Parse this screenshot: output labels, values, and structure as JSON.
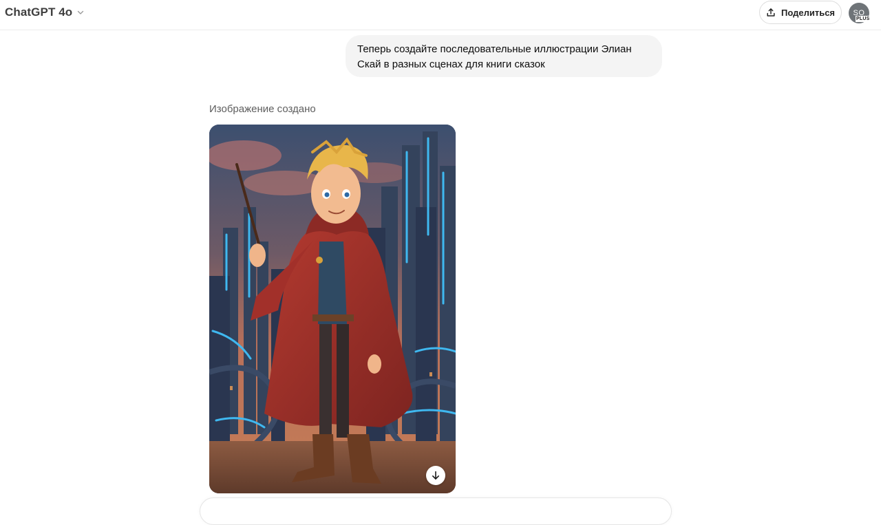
{
  "header": {
    "model_name": "ChatGPT 4o",
    "share_label": "Поделиться",
    "avatar_initials": "SO",
    "plan_badge": "PLUS"
  },
  "conversation": {
    "user_message": "Теперь создайте последовательные иллюстрации Элиан Скай в разных сценах для книги сказок",
    "assistant_status": "Изображение создано",
    "image": {
      "subject": "illustration of a blond boy in a red hooded robe holding a wand in front of a futuristic city at dusk"
    }
  },
  "icons": {
    "model_menu": "chevron-down-icon",
    "share": "share-upload-icon",
    "download": "arrow-down-icon"
  },
  "colors": {
    "user_bubble_bg": "#f4f4f4",
    "robe_red": "#a2302a",
    "neon_blue": "#3fb8f0"
  }
}
